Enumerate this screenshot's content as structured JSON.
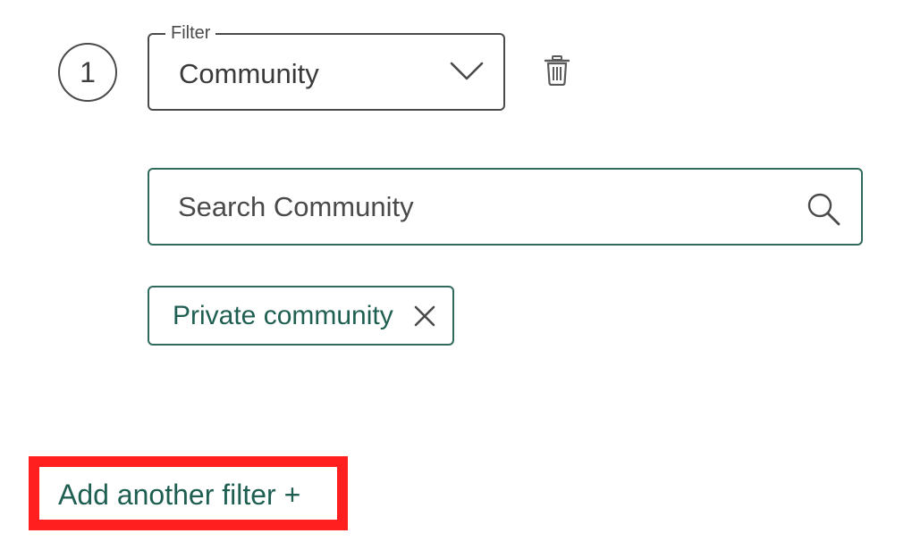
{
  "step": {
    "number": "1"
  },
  "filter": {
    "legend": "Filter",
    "selected_value": "Community"
  },
  "search": {
    "placeholder": "Search Community",
    "value": ""
  },
  "chips": [
    {
      "label": "Private community"
    }
  ],
  "actions": {
    "add_filter_label": "Add another filter +"
  },
  "icons": {
    "dropdown": "chevron-down-icon",
    "delete": "trash-icon",
    "search": "search-icon",
    "remove_chip": "close-icon"
  },
  "colors": {
    "accent": "#1f5f52",
    "border_neutral": "#4a4a4a",
    "highlight": "#ff1f1f"
  }
}
